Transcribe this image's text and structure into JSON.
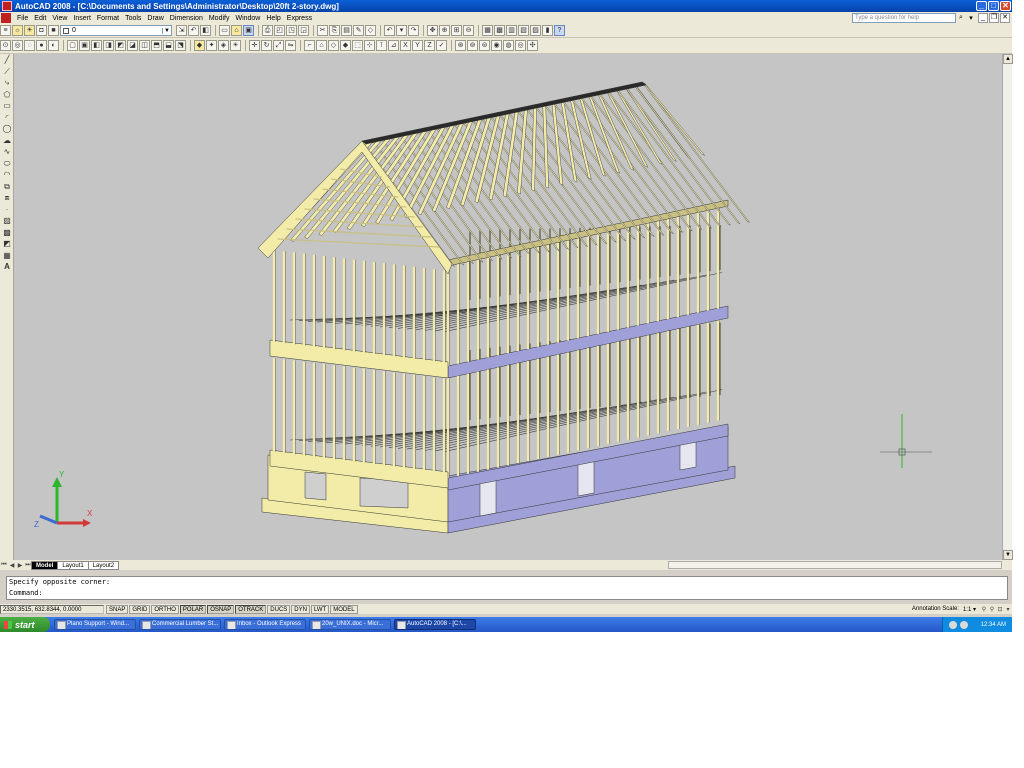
{
  "window": {
    "title": "AutoCAD 2008 - [C:\\Documents and Settings\\Administrator\\Desktop\\20ft 2-story.dwg]",
    "minimize": "_",
    "maximize": "□",
    "close": "✕"
  },
  "menu": {
    "items": [
      "File",
      "Edit",
      "View",
      "Insert",
      "Format",
      "Tools",
      "Draw",
      "Dimension",
      "Modify",
      "Window",
      "Help",
      "Express"
    ],
    "help_placeholder": "Type a question for help"
  },
  "layer_combo": {
    "value": "0"
  },
  "tabs": {
    "items": [
      "Model",
      "Layout1",
      "Layout2"
    ],
    "active": "Model"
  },
  "command": {
    "line1": "Specify opposite corner:",
    "line2": "Command:"
  },
  "status": {
    "coordinates": "2330.3515, 632.8344, 0.0000",
    "toggles": [
      "SNAP",
      "GRID",
      "ORTHO",
      "POLAR",
      "OSNAP",
      "OTRACK",
      "DUCS",
      "DYN",
      "LWT",
      "MODEL"
    ],
    "annotation_scale_label": "Annotation Scale:",
    "annotation_scale_value": "1:1 ▾"
  },
  "ucs": {
    "x_label": "X",
    "y_label": "Y",
    "z_label": "Z"
  },
  "taskbar": {
    "start_label": "start",
    "buttons": [
      "Plano Support - Wind...",
      "Commercial Lumber St...",
      "Inbox - Outlook Express",
      "20w_UNIX.doc - Micr...",
      "AutoCAD 2008 - [C:\\..."
    ],
    "active_index": 4,
    "clock": "12:34 AM"
  },
  "colors": {
    "viewport_bg": "#c5c5c5",
    "lumber": "#f3eca8",
    "lumber_shadow": "#c9c082",
    "sill_side": "#a0a0d8"
  }
}
